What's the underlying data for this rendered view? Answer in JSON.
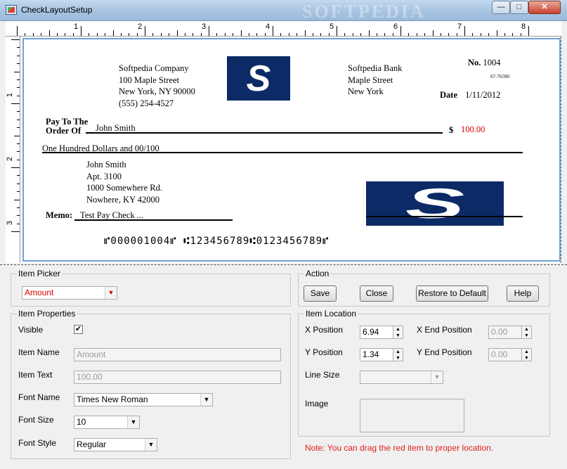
{
  "window": {
    "title": "CheckLayoutSetup",
    "watermark": "SOFTPEDIA",
    "min_icon": "minimize-icon",
    "max_icon": "maximize-icon",
    "close_icon": "close-icon"
  },
  "ruler": {
    "h_numbers": [
      "1",
      "2",
      "3",
      "4",
      "5",
      "6",
      "7",
      "8"
    ],
    "v_numbers": [
      "1",
      "2",
      "3"
    ]
  },
  "check": {
    "company_lines": [
      "Softpedia Company",
      "100 Maple Street",
      "New York, NY 90000",
      "(555) 254-4527"
    ],
    "logo_letter": "S",
    "bank_lines": [
      "Softpedia Bank",
      "Maple Street",
      "New York"
    ],
    "no_label": "No.",
    "check_no": "1004",
    "routing_fraction": "67-76590",
    "date_label": "Date",
    "date": "1/11/2012",
    "pay_to_label_1": "Pay To The",
    "pay_to_label_2": "Order Of",
    "payee": "John Smith",
    "dollar_sign": "$",
    "amount": "100.00",
    "amount_words": "One Hundred  Dollars and 00/100",
    "address_lines": [
      "John Smith",
      "Apt. 3100",
      "1000 Somewhere Rd.",
      "Nowhere, KY 42000"
    ],
    "memo_label": "Memo:",
    "memo": "Test Pay Check ...",
    "micr": "⑈000001004⑈ ⑆123456789⑆0123456789⑈"
  },
  "item_picker": {
    "title": "Item Picker",
    "selected": "Amount"
  },
  "action": {
    "title": "Action",
    "save": "Save",
    "close": "Close",
    "restore": "Restore to Default",
    "help": "Help"
  },
  "item_properties": {
    "title": "Item Properties",
    "visible_label": "Visible",
    "visible_check": "✔",
    "name_label": "Item Name",
    "name_value": "Amount",
    "text_label": "Item Text",
    "text_value": "100.00",
    "font_name_label": "Font Name",
    "font_name_value": "Times New Roman",
    "font_size_label": "Font Size",
    "font_size_value": "10",
    "font_style_label": "Font Style",
    "font_style_value": "Regular"
  },
  "item_location": {
    "title": "Item Location",
    "x_label": "X Position",
    "x_value": "6.94",
    "y_label": "Y Position",
    "y_value": "1.34",
    "x_end_label": "X End Position",
    "x_end_value": "0.00",
    "y_end_label": "Y End Position",
    "y_end_value": "0.00",
    "line_size_label": "Line Size",
    "image_label": "Image"
  },
  "note": "Note: You can drag the red item to proper location."
}
